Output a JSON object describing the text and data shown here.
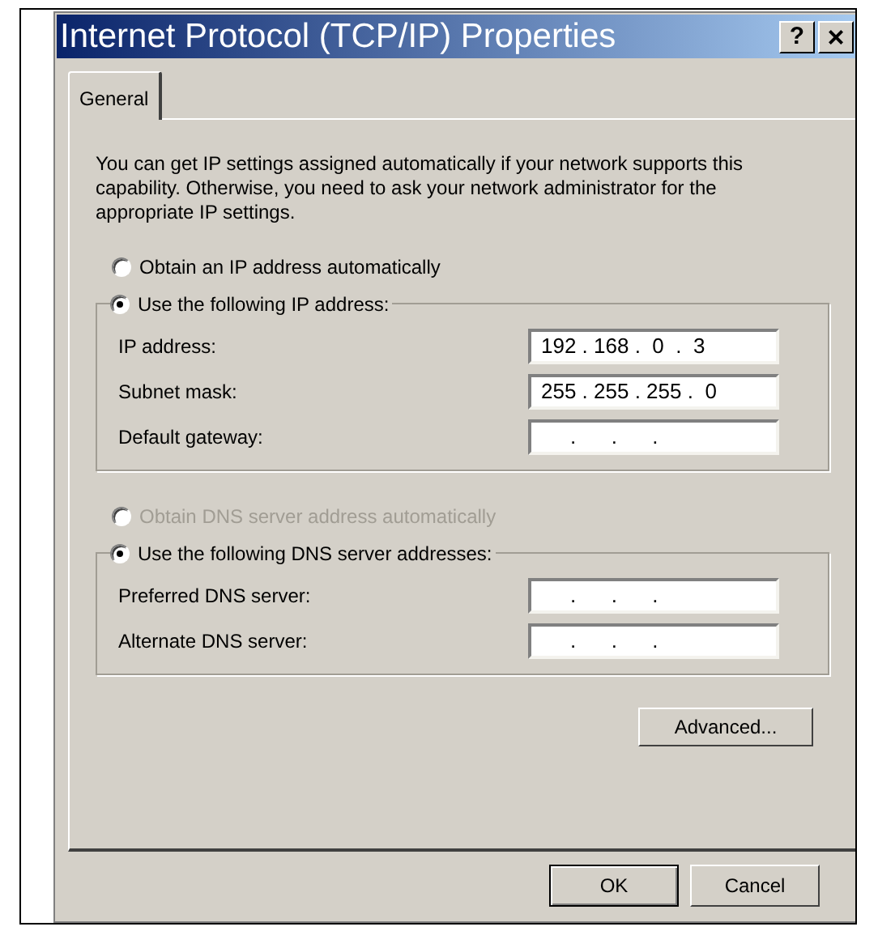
{
  "window": {
    "title": "Internet Protocol (TCP/IP) Properties",
    "help_button": "?",
    "close_button": "×"
  },
  "tabs": [
    {
      "label": "General",
      "selected": true
    }
  ],
  "description": "You can get IP settings assigned automatically if your network supports this capability. Otherwise, you need to ask your network administrator for the appropriate IP settings.",
  "ip_section": {
    "auto_option": {
      "label": "Obtain an IP address automatically",
      "selected": false,
      "disabled": false
    },
    "manual_option": {
      "label": "Use the following IP address:",
      "selected": true,
      "disabled": false
    },
    "fields": [
      {
        "label": "IP address:",
        "value": "192 . 168 .  0  .  3"
      },
      {
        "label": "Subnet mask:",
        "value": "255 . 255 . 255 .  0"
      },
      {
        "label": "Default gateway:",
        "value": "     .      .      ."
      }
    ]
  },
  "dns_section": {
    "auto_option": {
      "label": "Obtain DNS server address automatically",
      "selected": false,
      "disabled": true
    },
    "manual_option": {
      "label": "Use the following DNS server addresses:",
      "selected": true,
      "disabled": false
    },
    "fields": [
      {
        "label": "Preferred DNS server:",
        "value": "     .      .      ."
      },
      {
        "label": "Alternate DNS server:",
        "value": "     .      .      ."
      }
    ]
  },
  "advanced_button": "Advanced...",
  "buttons": [
    {
      "label": "OK",
      "default": true
    },
    {
      "label": "Cancel",
      "default": false
    }
  ]
}
